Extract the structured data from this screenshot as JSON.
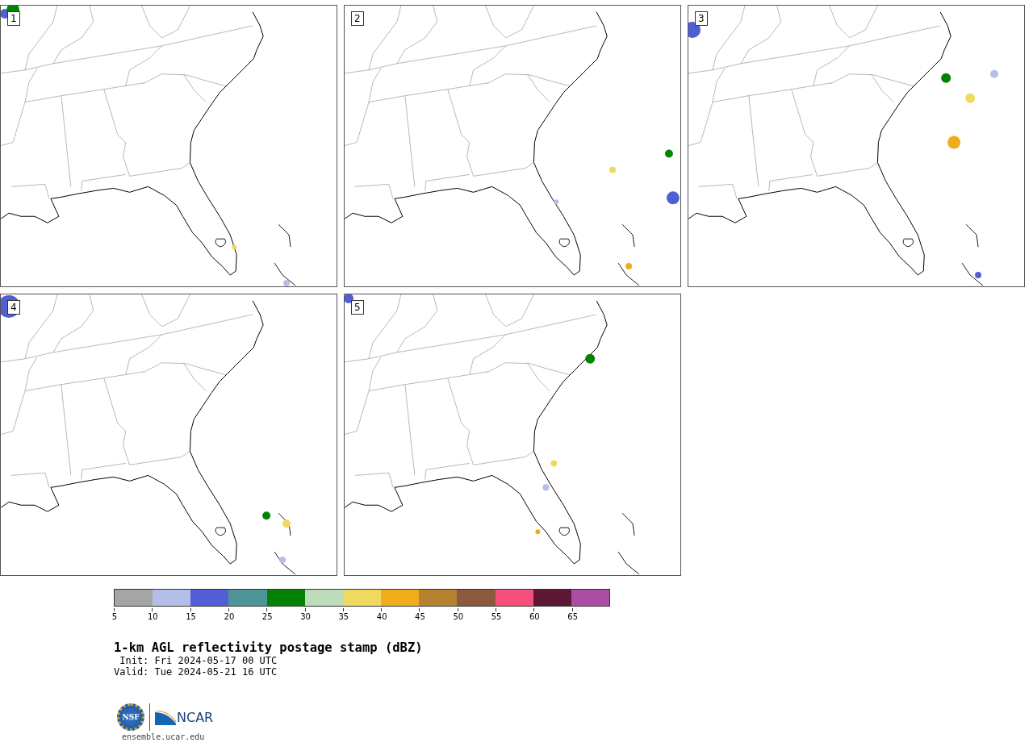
{
  "panels": [
    {
      "number": "1"
    },
    {
      "number": "2"
    },
    {
      "number": "3"
    },
    {
      "number": "4"
    },
    {
      "number": "5"
    }
  ],
  "colorbar": {
    "segments": [
      {
        "color": "#a5a5a5"
      },
      {
        "color": "#b5bee9"
      },
      {
        "color": "#505fd3"
      },
      {
        "color": "#4e9598"
      },
      {
        "color": "#038303"
      },
      {
        "color": "#bddcbc"
      },
      {
        "color": "#efd95e"
      },
      {
        "color": "#efad1b"
      },
      {
        "color": "#b7822f"
      },
      {
        "color": "#8b5a3e"
      },
      {
        "color": "#f4507b"
      },
      {
        "color": "#5d1733"
      },
      {
        "color": "#ab4da5"
      }
    ],
    "ticks": [
      "5",
      "10",
      "15",
      "20",
      "25",
      "30",
      "35",
      "40",
      "45",
      "50",
      "55",
      "60",
      "65"
    ]
  },
  "title": "1-km AGL reflectivity postage stamp (dBZ)",
  "init": " Init: Fri 2024-05-17 00 UTC",
  "valid": "Valid: Tue 2024-05-21 16 UTC",
  "logo": {
    "left_text": "NSF",
    "right_text": "NCAR"
  },
  "footer": "ensemble.ucar.edu"
}
